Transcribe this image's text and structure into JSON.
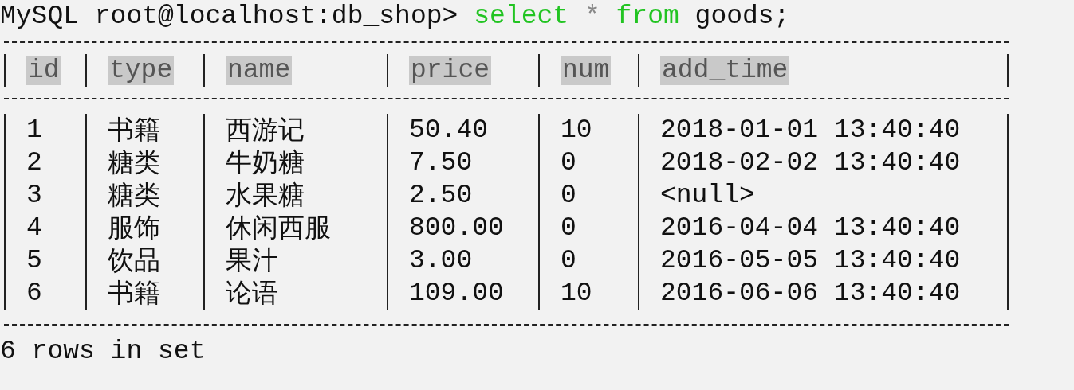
{
  "prompt": {
    "text": "MySQL root@localhost:db_shop>",
    "command": [
      {
        "text": "select",
        "kind": "keyword"
      },
      {
        "text": "*",
        "kind": "operator"
      },
      {
        "text": "from",
        "kind": "keyword"
      },
      {
        "text": "goods;",
        "kind": "plain"
      }
    ]
  },
  "table": {
    "columns": [
      "id",
      "type",
      "name",
      "price",
      "num",
      "add_time"
    ],
    "rows": [
      [
        "1",
        "书籍",
        "西游记",
        "50.40",
        "10",
        "2018-01-01 13:40:40"
      ],
      [
        "2",
        "糖类",
        "牛奶糖",
        "7.50",
        "0",
        "2018-02-02 13:40:40"
      ],
      [
        "3",
        "糖类",
        "水果糖",
        "2.50",
        "0",
        "<null>"
      ],
      [
        "4",
        "服饰",
        "休闲西服",
        "800.00",
        "0",
        "2016-04-04 13:40:40"
      ],
      [
        "5",
        "饮品",
        "果汁",
        "3.00",
        "0",
        "2016-05-05 13:40:40"
      ],
      [
        "6",
        "书籍",
        "论语",
        "109.00",
        "10",
        "2016-06-06 13:40:40"
      ]
    ]
  },
  "status": "6 rows in set"
}
